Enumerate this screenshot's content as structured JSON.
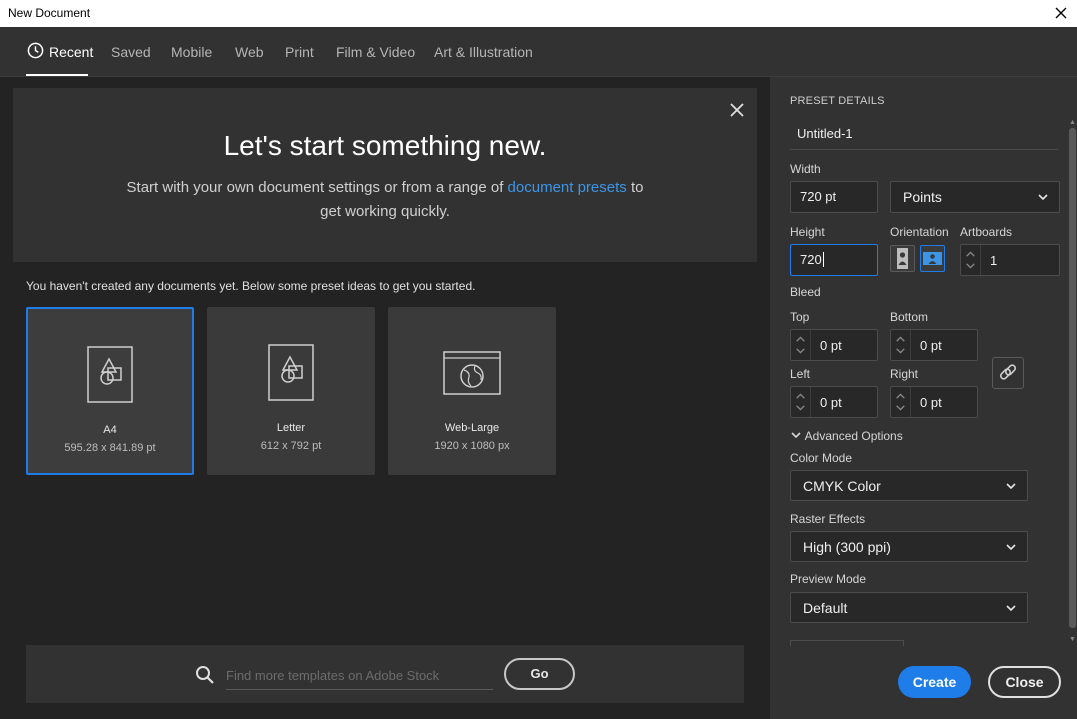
{
  "window": {
    "title": "New Document"
  },
  "tabs": [
    {
      "label": "Recent",
      "active": true
    },
    {
      "label": "Saved"
    },
    {
      "label": "Mobile"
    },
    {
      "label": "Web"
    },
    {
      "label": "Print"
    },
    {
      "label": "Film & Video"
    },
    {
      "label": "Art & Illustration"
    }
  ],
  "hero": {
    "title": "Let's start something new.",
    "subtitle_before": "Start with your own document settings or from a range of ",
    "subtitle_link": "document presets",
    "subtitle_after": " to",
    "subtitle_line2": "get working quickly."
  },
  "hint": "You haven't created any documents yet. Below some preset ideas to get you started.",
  "presets": [
    {
      "name": "A4",
      "dims": "595.28 x 841.89 pt",
      "icon": "document-shapes-icon",
      "selected": true
    },
    {
      "name": "Letter",
      "dims": "612 x 792 pt",
      "icon": "document-shapes-icon"
    },
    {
      "name": "Web-Large",
      "dims": "1920 x 1080 px",
      "icon": "browser-globe-icon"
    }
  ],
  "search": {
    "placeholder": "Find more templates on Adobe Stock",
    "go_label": "Go"
  },
  "details": {
    "heading": "PRESET DETAILS",
    "name": "Untitled-1",
    "width_label": "Width",
    "width_value": "720 pt",
    "units": "Points",
    "height_label": "Height",
    "height_value": "720",
    "orientation_label": "Orientation",
    "artboards_label": "Artboards",
    "artboards_value": "1",
    "bleed_label": "Bleed",
    "top_label": "Top",
    "top_value": "0 pt",
    "bottom_label": "Bottom",
    "bottom_value": "0 pt",
    "left_label": "Left",
    "left_value": "0 pt",
    "right_label": "Right",
    "right_value": "0 pt",
    "advanced_label": "Advanced Options",
    "color_mode_label": "Color Mode",
    "color_mode_value": "CMYK Color",
    "raster_label": "Raster Effects",
    "raster_value": "High (300 ppi)",
    "preview_label": "Preview Mode",
    "preview_value": "Default"
  },
  "actions": {
    "create": "Create",
    "close": "Close"
  },
  "colors": {
    "accent": "#1e7de8",
    "link": "#3d95e8",
    "panel": "#323232",
    "background": "#232323"
  }
}
